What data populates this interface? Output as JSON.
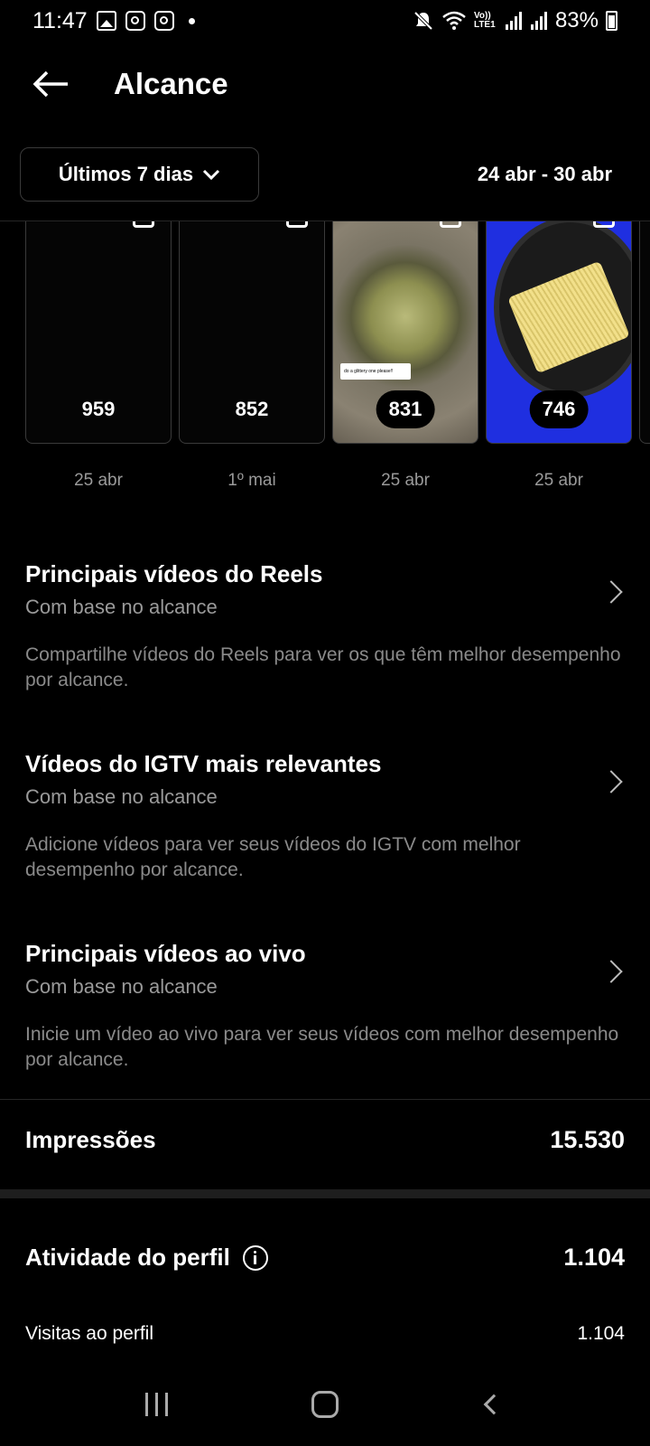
{
  "status_bar": {
    "time": "11:47",
    "network": "Vo)) LTE1",
    "battery": "83%",
    "icons": [
      "gallery-icon",
      "instagram-icon",
      "instagram-icon",
      "dot-icon",
      "mute-icon",
      "wifi-icon",
      "signal-icon",
      "battery-icon"
    ]
  },
  "header": {
    "title": "Alcance",
    "back_icon": "arrow-left-icon"
  },
  "filter": {
    "range_label": "Últimos 7 dias",
    "date_range": "24 abr - 30 abr"
  },
  "thumbnails": [
    {
      "count": "959",
      "date": "25 abr",
      "style": "dark"
    },
    {
      "count": "852",
      "date": "1º mai",
      "style": "dark"
    },
    {
      "count": "831",
      "date": "25 abr",
      "style": "pot",
      "sticker": "do a glittery one please!!"
    },
    {
      "count": "746",
      "date": "25 abr",
      "style": "pasta"
    }
  ],
  "sections": [
    {
      "title": "Principais vídeos do Reels",
      "subtitle": "Com base no alcance",
      "description": "Compartilhe vídeos do Reels para ver os que têm melhor desempenho por alcance."
    },
    {
      "title": "Vídeos do IGTV mais relevantes",
      "subtitle": "Com base no alcance",
      "description": "Adicione vídeos para ver seus vídeos do IGTV com melhor desempenho por alcance."
    },
    {
      "title": "Principais vídeos ao vivo",
      "subtitle": "Com base no alcance",
      "description": "Inicie um vídeo ao vivo para ver seus vídeos com melhor desempenho por alcance."
    }
  ],
  "impressions": {
    "label": "Impressões",
    "value": "15.530"
  },
  "profile_activity": {
    "label": "Atividade do perfil",
    "value": "1.104",
    "rows": [
      {
        "label": "Visitas ao perfil",
        "value": "1.104"
      }
    ]
  },
  "colors": {
    "background": "#000000",
    "text": "#ffffff",
    "muted": "#9a9a9a",
    "divider": "#262626",
    "pasta_bg": "#1f2fe0"
  }
}
